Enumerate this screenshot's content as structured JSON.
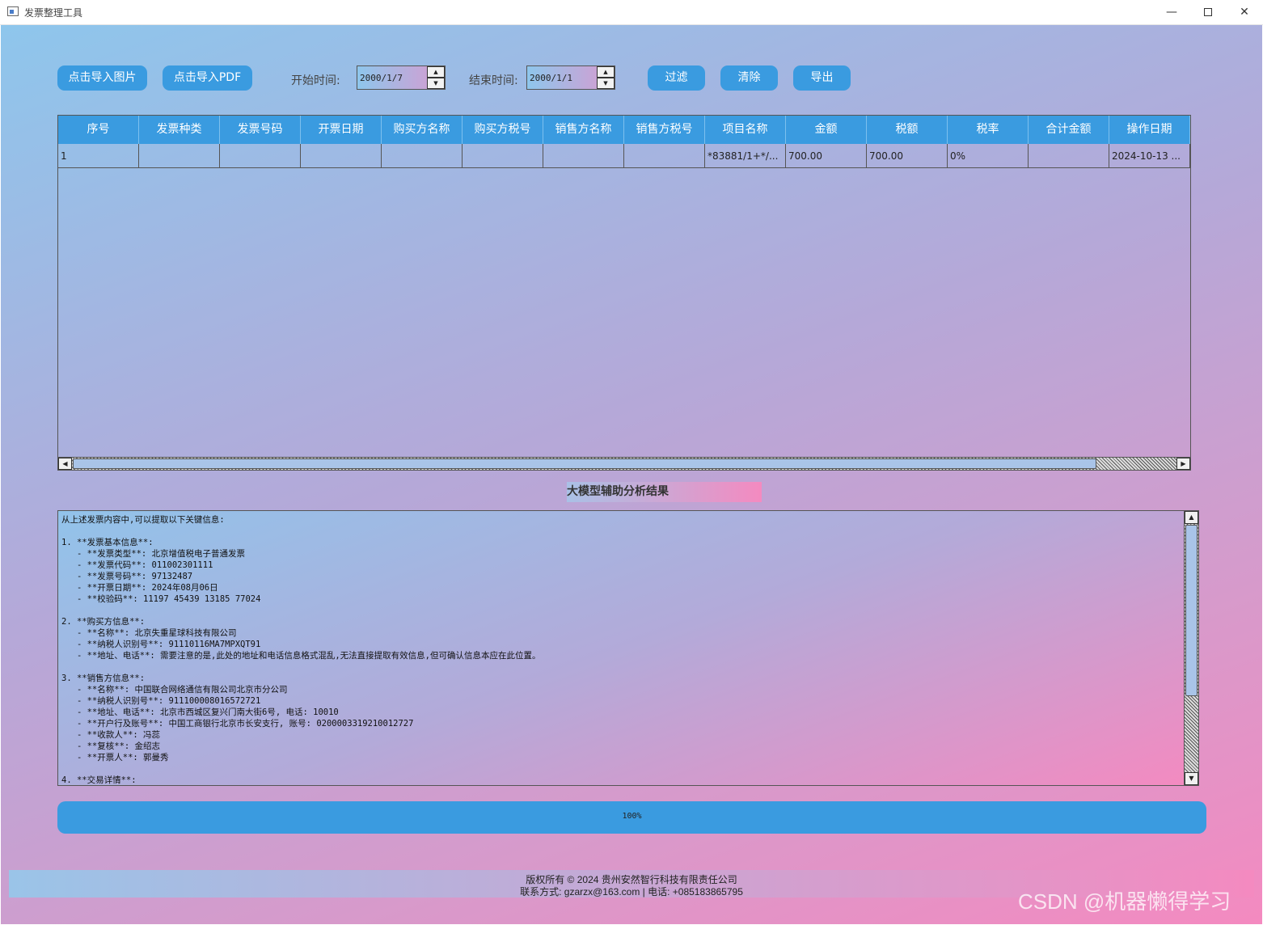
{
  "window": {
    "title": "发票整理工具",
    "min_glyph": "—",
    "close_glyph": "✕"
  },
  "toolbar": {
    "import_image": "点击导入图片",
    "import_pdf": "点击导入PDF",
    "start_label": "开始时间:",
    "start_value": "2000/1/7",
    "end_label": "结束时间:",
    "end_value": "2000/1/1",
    "filter": "过滤",
    "clear": "清除",
    "export": "导出",
    "spin_up": "▲",
    "spin_down": "▼"
  },
  "table": {
    "headers": [
      "序号",
      "发票种类",
      "发票号码",
      "开票日期",
      "购买方名称",
      "购买方税号",
      "销售方名称",
      "销售方税号",
      "项目名称",
      "金额",
      "税额",
      "税率",
      "合计金额",
      "操作日期"
    ],
    "rows": [
      [
        "1",
        "",
        "",
        "",
        "",
        "",
        "",
        "",
        "*83881/1+*/...",
        "700.00",
        "700.00",
        "0%",
        "",
        "2024-10-13 ..."
      ]
    ],
    "scroll_left": "◀",
    "scroll_right": "▶"
  },
  "analysis": {
    "title": "大模型辅助分析结果",
    "text": "从上述发票内容中,可以提取以下关键信息:\n\n1. **发票基本信息**:\n   - **发票类型**: 北京增值税电子普通发票\n   - **发票代码**: 011002301111\n   - **发票号码**: 97132487\n   - **开票日期**: 2024年08月06日\n   - **校验码**: 11197 45439 13185 77024\n\n2. **购买方信息**:\n   - **名称**: 北京失重星球科技有限公司\n   - **纳税人识别号**: 91110116MA7MPXQT91\n   - **地址、电话**: 需要注意的是,此处的地址和电话信息格式混乱,无法直接提取有效信息,但可确认信息本应在此位置。\n\n3. **销售方信息**:\n   - **名称**: 中国联合网络通信有限公司北京市分公司\n   - **纳税人识别号**: 911100008016572721\n   - **地址、电话**: 北京市西城区复兴门南大街6号, 电话: 10010\n   - **开户行及账号**: 中国工商银行北京市长安支行, 账号: 0200003319210012727\n   - **收款人**: 冯蕊\n   - **复核**: 金绍志\n   - **开票人**: 郭曼秀\n\n4. **交易详情**:",
    "scroll_up": "▲",
    "scroll_down": "▼"
  },
  "progress": {
    "text": "100%",
    "value": 100
  },
  "footer": {
    "copyright": "版权所有 © 2024 贵州安然智行科技有限责任公司",
    "contact": "联系方式: gzarzx@163.com | 电话: +085183865795"
  },
  "watermark": "CSDN @机器懒得学习",
  "colors": {
    "accent": "#3a9be0",
    "gradient_start": "#8ec6ec",
    "gradient_end": "#f48ac0"
  }
}
